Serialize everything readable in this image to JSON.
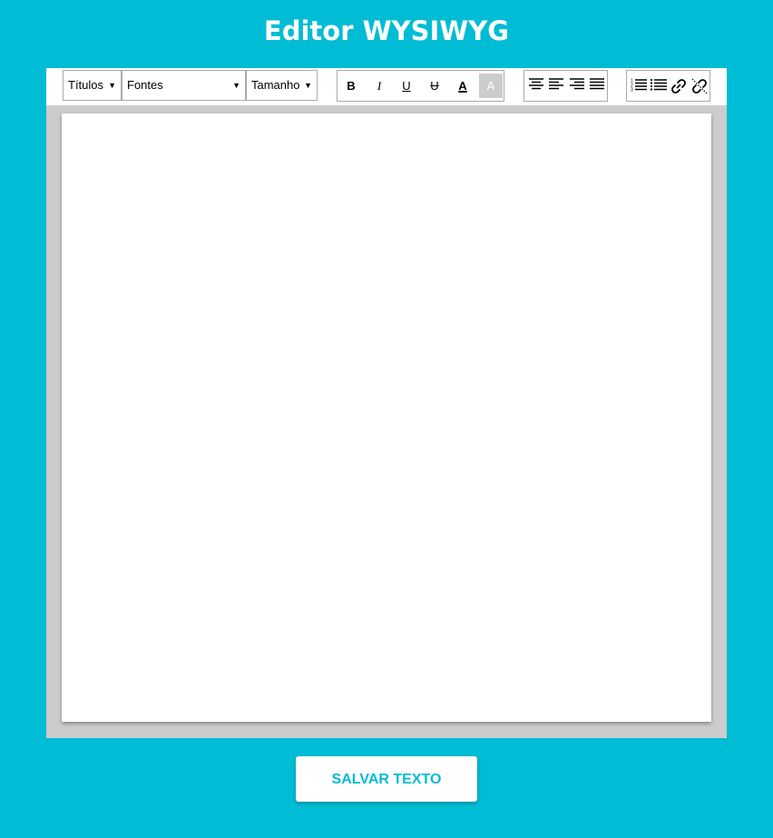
{
  "header": {
    "title": "Editor WYSIWYG"
  },
  "toolbar": {
    "headings_select": {
      "label": "Títulos"
    },
    "fonts_select": {
      "label": "Fontes"
    },
    "size_select": {
      "label": "Tamanho"
    },
    "format": {
      "bold": "B",
      "italic": "I",
      "underline": "U",
      "strikethrough": "U",
      "font_color": "A",
      "highlight": "A"
    },
    "icons": {
      "align": [
        "align-center-icon",
        "align-left-icon",
        "align-right-icon",
        "align-justify-icon"
      ],
      "lists": [
        "ordered-list-icon",
        "unordered-list-icon"
      ],
      "links": [
        "link-icon",
        "unlink-icon"
      ]
    }
  },
  "editor": {
    "content": ""
  },
  "actions": {
    "save_label": "SALVAR TEXTO"
  },
  "colors": {
    "background": "#00bcd4",
    "toolbar_bg": "#ffffff",
    "editor_frame": "#cccccc",
    "button_text": "#00bcd4"
  }
}
